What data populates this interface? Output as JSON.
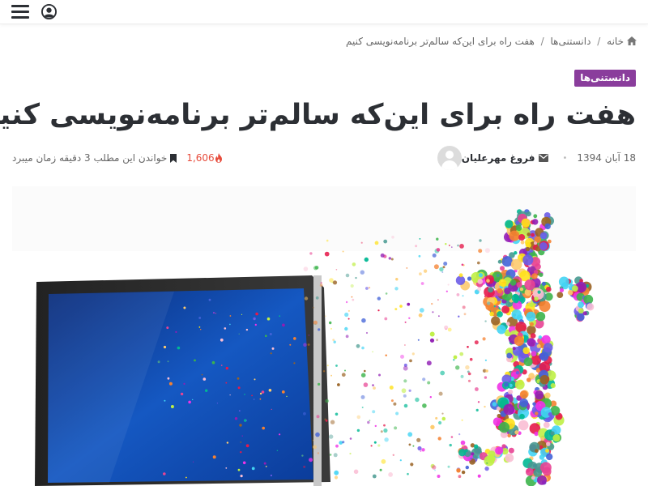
{
  "header": {
    "menu_icon": "hamburger-menu-icon",
    "user_icon": "user-circle-icon"
  },
  "breadcrumb": {
    "home_label": "خانه",
    "home_icon": "home-icon",
    "separator": "/",
    "category_label": "دانستنی‌ها",
    "current_label": "هفت راه برای این‌که سالم‌تر برنامه‌نویسی کنیم"
  },
  "post": {
    "category_badge": "دانستنی‌ها",
    "title": "هفت راه برای این‌که سالم‌تر برنامه‌نویسی کنیم",
    "author": "فروغ مهرعلیان",
    "date": "18 آبان 1394",
    "views": "1,606",
    "reading_time": "خواندن این مطلب 3 دقیقه زمان میبرد",
    "image_description_icon": "featured-image"
  },
  "colors": {
    "badge_bg": "#8a3d9c",
    "title_text": "#2c2f34",
    "meta_text": "#666666",
    "views_color": "#e74c3c"
  }
}
